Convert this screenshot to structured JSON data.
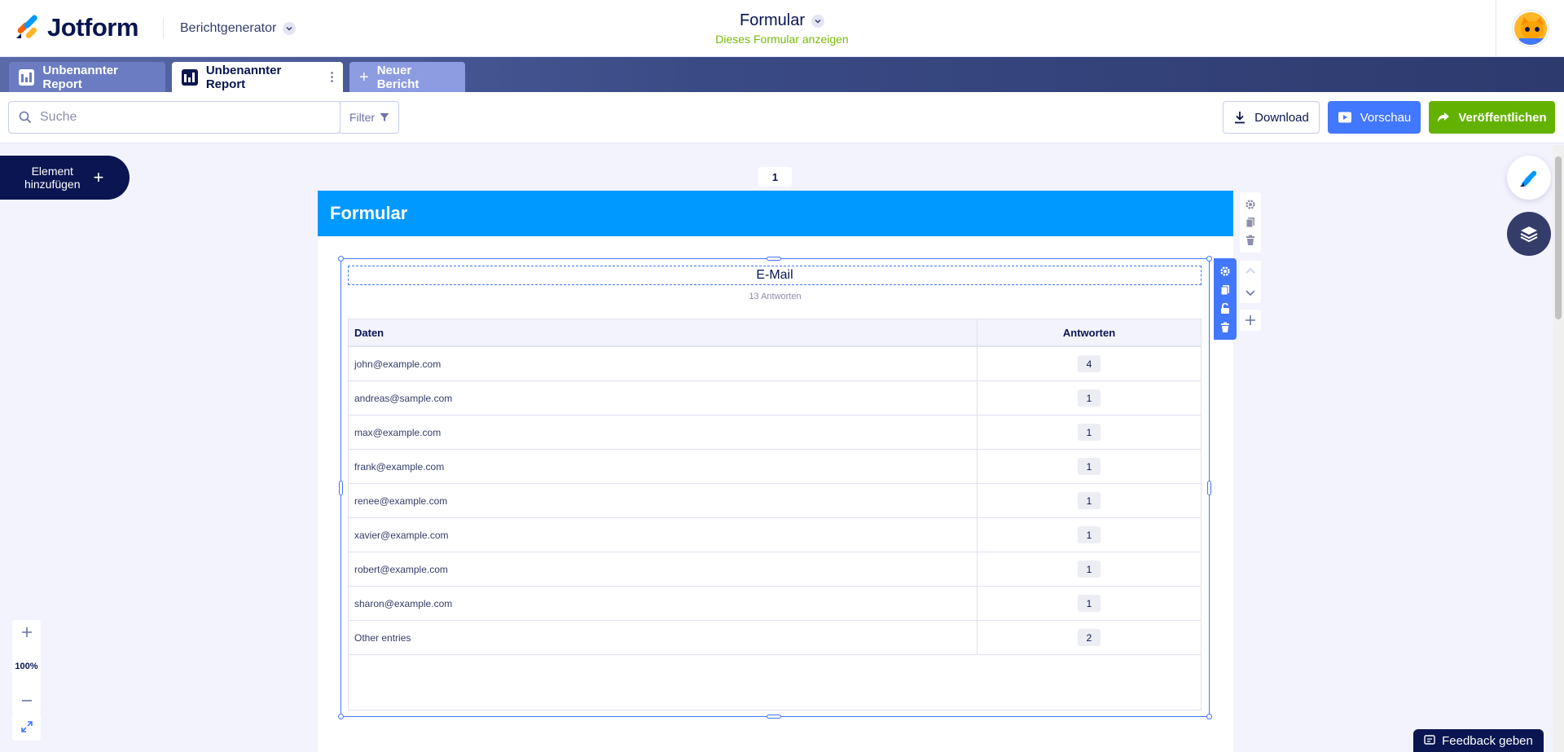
{
  "header": {
    "logo_text": "Jotform",
    "app_switcher_label": "Berichtgenerator",
    "form_title": "Formular",
    "form_link": "Dieses Formular anzeigen"
  },
  "tabs": [
    {
      "label": "Unbenannter Report",
      "state": "inactive"
    },
    {
      "label": "Unbenannter Report",
      "state": "active"
    },
    {
      "label": "Neuer Bericht",
      "state": "add"
    }
  ],
  "toolbar": {
    "search_placeholder": "Suche",
    "filter_label": "Filter",
    "download_label": "Download",
    "preview_label": "Vorschau",
    "publish_label": "Veröffentlichen"
  },
  "canvas": {
    "add_element_line1": "Element",
    "add_element_line2": "hinzufügen",
    "page_number": "1",
    "page_header": "Formular",
    "zoom_level": "100%"
  },
  "widget": {
    "title": "E-Mail",
    "subtitle": "13 Antworten",
    "columns": [
      "Daten",
      "Antworten"
    ],
    "rows": [
      {
        "label": "john@example.com",
        "count": "4"
      },
      {
        "label": "andreas@sample.com",
        "count": "1"
      },
      {
        "label": "max@example.com",
        "count": "1"
      },
      {
        "label": "frank@example.com",
        "count": "1"
      },
      {
        "label": "renee@example.com",
        "count": "1"
      },
      {
        "label": "xavier@example.com",
        "count": "1"
      },
      {
        "label": "robert@example.com",
        "count": "1"
      },
      {
        "label": "sharon@example.com",
        "count": "1"
      },
      {
        "label": "Other entries",
        "count": "2"
      }
    ]
  },
  "feedback_label": "Feedback geben",
  "colors": {
    "navy": "#0a1551",
    "header_blue": "#0099ff",
    "preview_blue": "#4277ff",
    "publish_green": "#64b200",
    "link_green": "#78bb07"
  }
}
